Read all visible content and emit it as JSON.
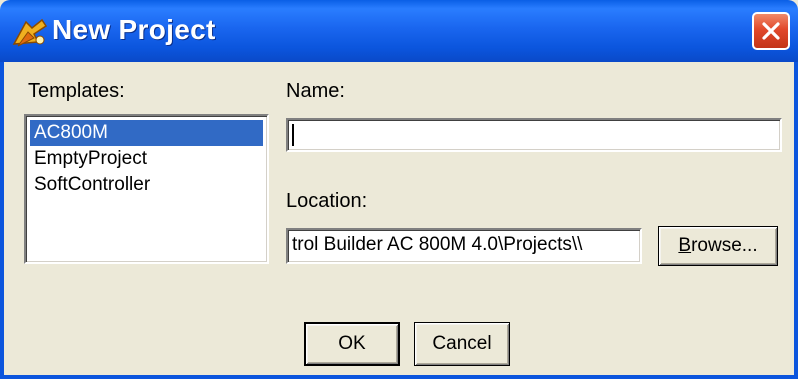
{
  "window": {
    "title": "New Project",
    "icons": {
      "app": "project-wizard-icon",
      "close": "close-x-icon"
    }
  },
  "templates": {
    "label": "Templates:",
    "items": [
      "AC800M",
      "EmptyProject",
      "SoftController"
    ],
    "selected": "AC800M"
  },
  "name": {
    "label": "Name:",
    "value": ""
  },
  "location": {
    "label": "Location:",
    "value": "trol Builder AC 800M 4.0\\Projects\\\\"
  },
  "buttons": {
    "browse_prefix": "B",
    "browse_rest": "rowse...",
    "ok": "OK",
    "cancel": "Cancel"
  },
  "colors": {
    "titlebar": "#0b55dd",
    "selection": "#316ac5",
    "dialog_bg": "#ece9d8",
    "close_button": "#e1492b"
  }
}
